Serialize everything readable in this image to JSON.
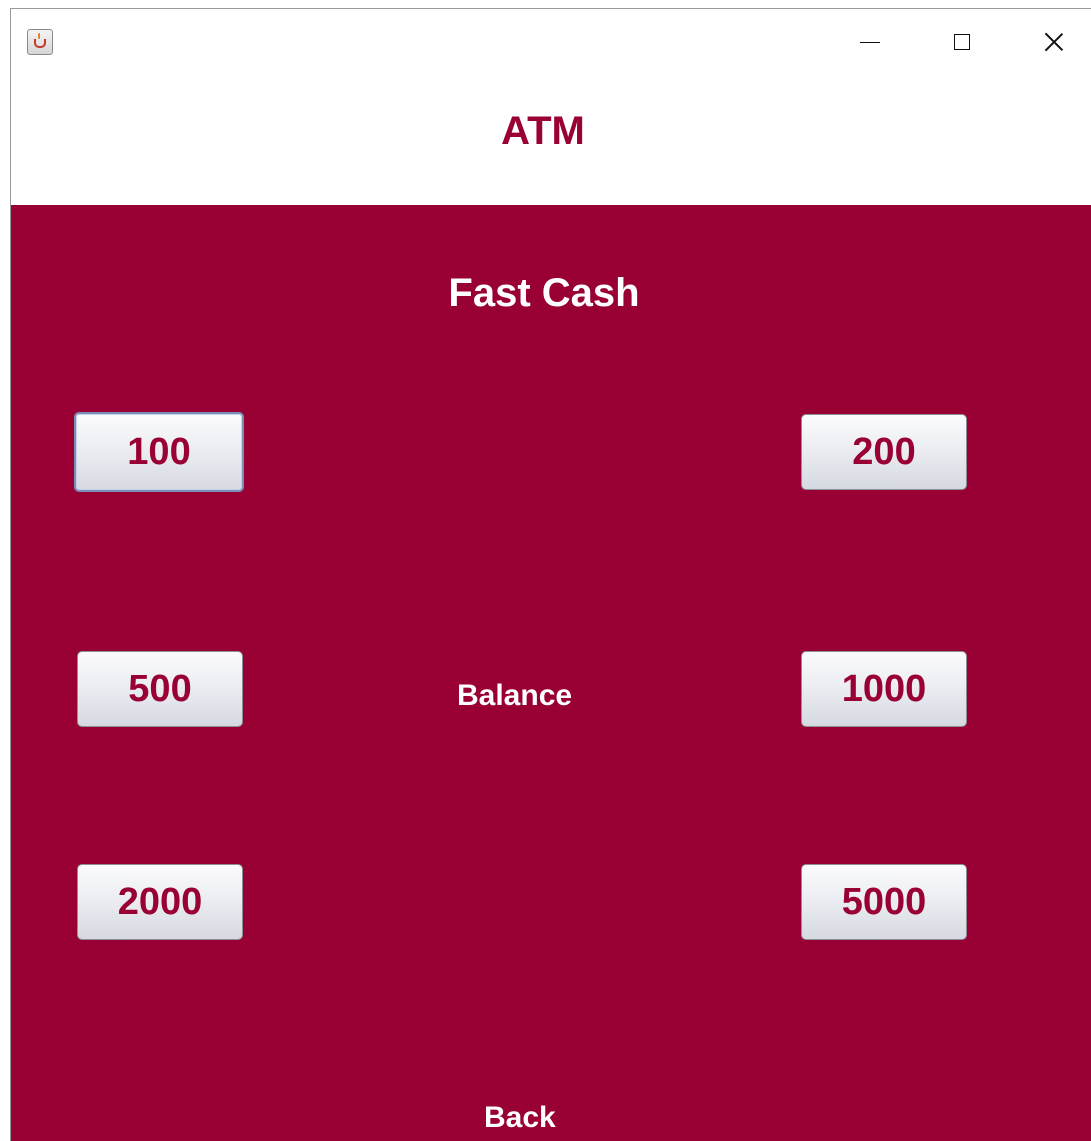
{
  "window": {
    "icon": "java-cup-icon",
    "controls": {
      "minimize_icon": "minimize-icon",
      "maximize_icon": "maximize-icon",
      "close_icon": "close-icon"
    }
  },
  "header": {
    "title": "ATM"
  },
  "panel": {
    "title": "Fast Cash",
    "amounts": {
      "a100": "100",
      "a200": "200",
      "a500": "500",
      "a1000": "1000",
      "a2000": "2000",
      "a5000": "5000"
    },
    "balance_label": "Balance",
    "back_label": "Back"
  },
  "colors": {
    "accent": "#990033",
    "text_on_accent": "#ffffff",
    "header_background": "#ffffff"
  }
}
